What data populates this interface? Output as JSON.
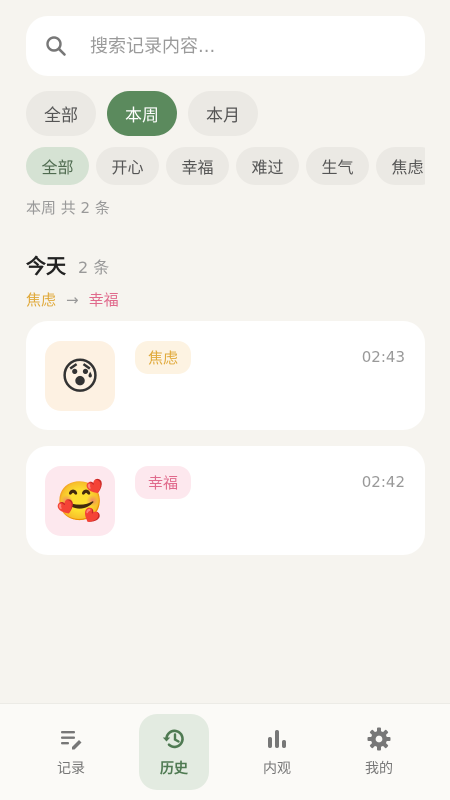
{
  "search": {
    "placeholder": "搜索记录内容..."
  },
  "period_tabs": [
    {
      "label": "全部",
      "active": false
    },
    {
      "label": "本周",
      "active": true
    },
    {
      "label": "本月",
      "active": false
    }
  ],
  "mood_filters": [
    {
      "label": "全部",
      "active": true
    },
    {
      "label": "开心",
      "active": false
    },
    {
      "label": "幸福",
      "active": false
    },
    {
      "label": "难过",
      "active": false
    },
    {
      "label": "生气",
      "active": false
    },
    {
      "label": "焦虑",
      "active": false
    }
  ],
  "summary": {
    "text": "本周 共 2 条"
  },
  "group": {
    "title": "今天",
    "count": "2 条",
    "flow": {
      "from": "焦虑",
      "arrow": "→",
      "to": "幸福"
    }
  },
  "entries": [
    {
      "emoji": "😰",
      "tag": "焦虑",
      "time": "02:43",
      "tag_color": "#e0a93a",
      "tag_bg": "#fdf3e2",
      "emoji_bg": "#fdf1e2"
    },
    {
      "emoji": "🥰",
      "tag": "幸福",
      "time": "02:42",
      "tag_color": "#e06a8c",
      "tag_bg": "#fde8ee",
      "emoji_bg": "#fde8ee"
    }
  ],
  "tabbar": [
    {
      "label": "记录",
      "icon": "edit-list-icon",
      "active": false
    },
    {
      "label": "历史",
      "icon": "history-icon",
      "active": true
    },
    {
      "label": "内观",
      "icon": "bar-chart-icon",
      "active": false
    },
    {
      "label": "我的",
      "icon": "gear-icon",
      "active": false
    }
  ],
  "colors": {
    "accent": "#5b8a5d",
    "background": "#f6f4ef"
  }
}
